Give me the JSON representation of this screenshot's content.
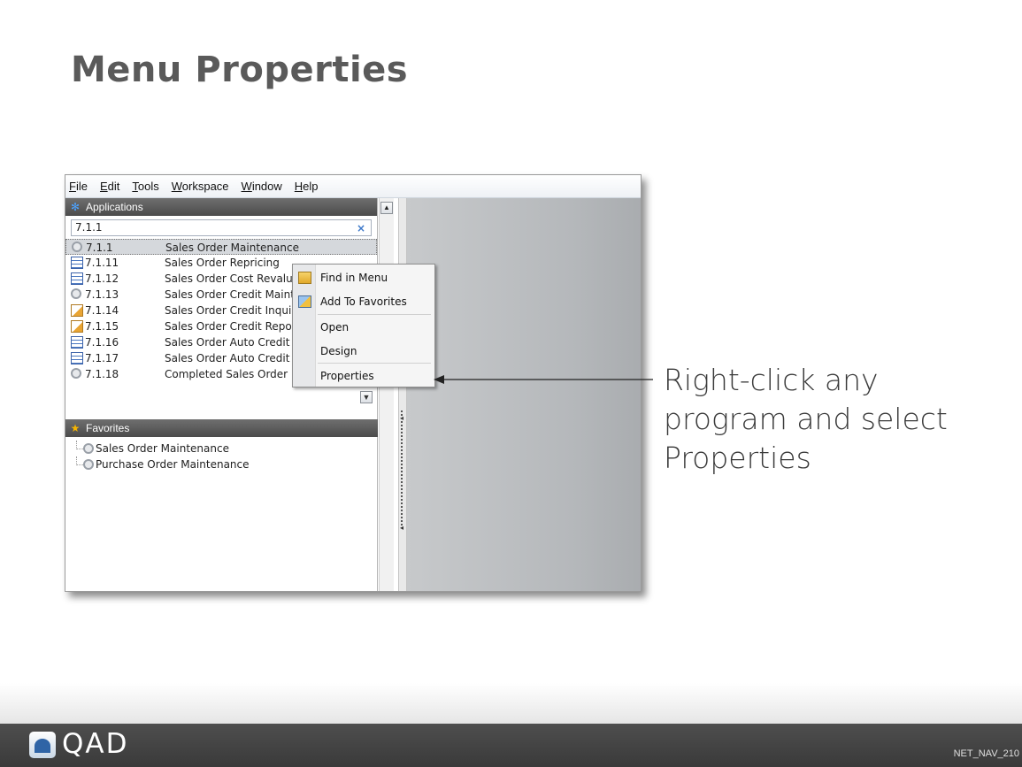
{
  "slide": {
    "title": "Menu Properties"
  },
  "menubar": [
    "File",
    "Edit",
    "Tools",
    "Workspace",
    "Window",
    "Help"
  ],
  "applications": {
    "header": "Applications",
    "search_value": "7.1.1",
    "search_clear": "×",
    "rows": [
      {
        "code": "7.1.1",
        "name": "Sales Order Maintenance",
        "icon": "gear-icon"
      },
      {
        "code": "7.1.11",
        "name": "Sales Order Repricing",
        "icon": "grid-icon"
      },
      {
        "code": "7.1.12",
        "name": "Sales Order Cost Revaluation",
        "icon": "grid-icon"
      },
      {
        "code": "7.1.13",
        "name": "Sales Order Credit Maintenance",
        "icon": "gear-icon"
      },
      {
        "code": "7.1.14",
        "name": "Sales Order Credit Inquiry",
        "icon": "report-icon"
      },
      {
        "code": "7.1.15",
        "name": "Sales Order Credit Report",
        "icon": "report-icon"
      },
      {
        "code": "7.1.16",
        "name": "Sales Order Auto Credit Hold",
        "icon": "grid-icon"
      },
      {
        "code": "7.1.17",
        "name": "Sales Order Auto Credit Approval",
        "icon": "grid-icon"
      },
      {
        "code": "7.1.18",
        "name": "Completed Sales Order Delete",
        "icon": "gear-icon"
      }
    ]
  },
  "favorites": {
    "header": "Favorites",
    "items": [
      "Sales Order Maintenance",
      "Purchase Order Maintenance"
    ]
  },
  "context_menu": {
    "find": "Find in Menu",
    "add_fav": "Add To Favorites",
    "open": "Open",
    "design": "Design",
    "properties": "Properties"
  },
  "callout": {
    "text": "Right-click any program and select Properties"
  },
  "footer": {
    "logo": "QAD",
    "code": "NET_NAV_210"
  }
}
